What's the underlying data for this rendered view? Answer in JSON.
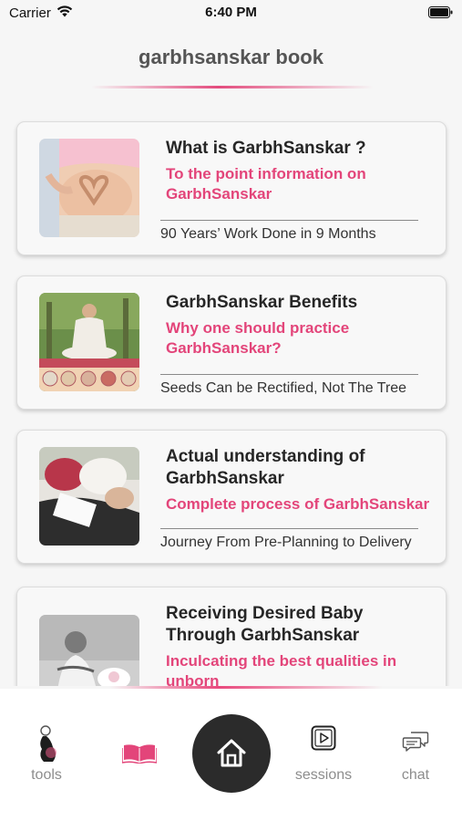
{
  "status_bar": {
    "carrier": "Carrier",
    "time": "6:40 PM"
  },
  "header": {
    "title": "garbhsanskar book",
    "accent_color": "#e3457a"
  },
  "cards": [
    {
      "title": "What is GarbhSanskar ?",
      "subtitle": "To the point information on GarbhSanskar",
      "footer": "90 Years’ Work Done in 9 Months",
      "image": "pregnant-belly-heart-hands-image"
    },
    {
      "title": "GarbhSanskar Benefits",
      "subtitle": "Why one should practice GarbhSanskar?",
      "footer": "Seeds Can be Rectified, Not The Tree",
      "image": "meditating-pregnant-woman-image"
    },
    {
      "title": "Actual understanding of GarbhSanskar",
      "subtitle": "Complete process of GarbhSanskar",
      "footer": "Journey From Pre-Planning to Delivery",
      "image": "pregnant-women-reading-image"
    },
    {
      "title": "Receiving Desired Baby Through GarbhSanskar",
      "subtitle": "Inculcating the best qualities in unborn",
      "footer": "",
      "image": "mother-dreaming-baby-image"
    }
  ],
  "bottom_nav": {
    "items": [
      {
        "label": "tools",
        "icon": "pregnant-silhouette-icon"
      },
      {
        "label": "",
        "icon": "open-book-icon",
        "active": true
      },
      {
        "label": "",
        "icon": "home-icon"
      },
      {
        "label": "sessions",
        "icon": "play-video-icon"
      },
      {
        "label": "chat",
        "icon": "chat-bubbles-icon"
      }
    ]
  }
}
